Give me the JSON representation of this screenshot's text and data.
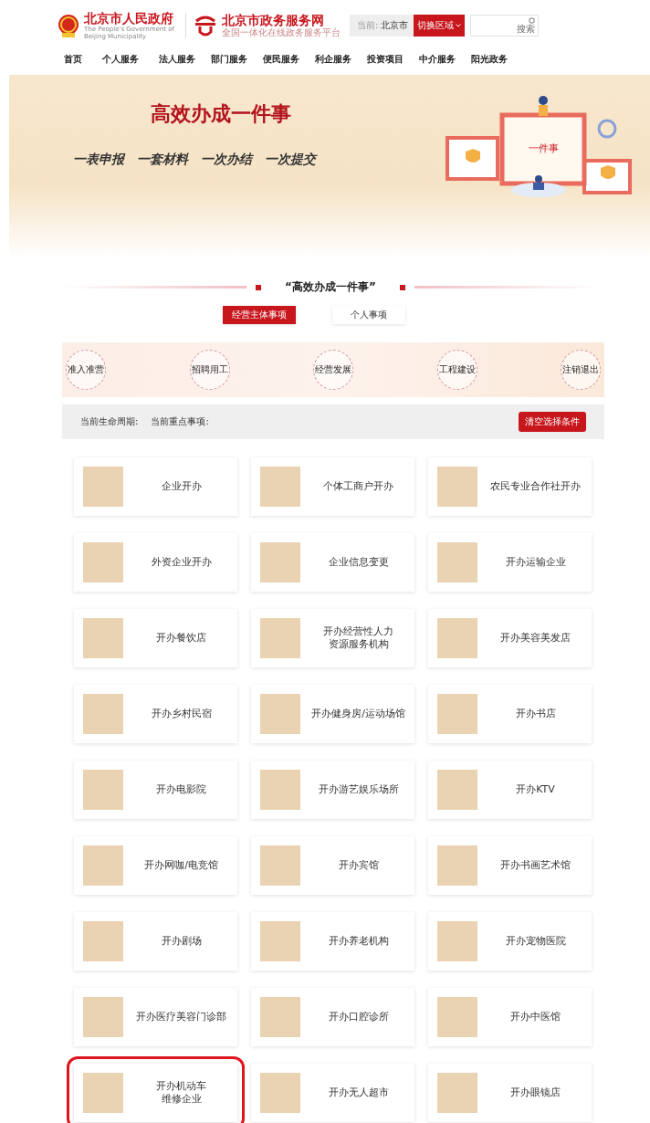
{
  "header": {
    "gov_title": "北京市人民政府",
    "gov_subtitle": "The People's Government of Beijing Municipality",
    "portal_title": "北京市政务服务网",
    "portal_subtitle": "全国一体化在线政务服务平台",
    "region_label": "当前:",
    "region_value": "北京市",
    "region_button": "切换区域",
    "search_label": "搜索"
  },
  "nav": [
    "首页",
    "个人服务",
    "法人服务",
    "部门服务",
    "便民服务",
    "利企服务",
    "投资项目",
    "中介服务",
    "阳光政务"
  ],
  "banner": {
    "title": "高效办成一件事",
    "slogans": [
      "一表申报",
      "一套材料",
      "一次办结",
      "一次提交"
    ],
    "screen_text": "一件事"
  },
  "section_title": "“高效办成一件事”",
  "tabs": [
    {
      "label": "经营主体事项",
      "selected": true
    },
    {
      "label": "个人事项",
      "selected": false
    }
  ],
  "lifecycle": [
    "准入准营",
    "招聘用工",
    "经营发展",
    "工程建设",
    "注销退出"
  ],
  "filter": {
    "period_label": "当前生命周期:",
    "focus_label": "当前重点事项:",
    "clear_button": "清空选择条件"
  },
  "cards": [
    {
      "lines": [
        "企业开办"
      ],
      "highlighted": false
    },
    {
      "lines": [
        "个体工商户开办"
      ],
      "highlighted": false
    },
    {
      "lines": [
        "农民专业合作社开办"
      ],
      "highlighted": false
    },
    {
      "lines": [
        "外资企业开办"
      ],
      "highlighted": false
    },
    {
      "lines": [
        "企业信息变更"
      ],
      "highlighted": false
    },
    {
      "lines": [
        "开办运输企业"
      ],
      "highlighted": false
    },
    {
      "lines": [
        "开办餐饮店"
      ],
      "highlighted": false
    },
    {
      "lines": [
        "开办经营性人力",
        "资源服务机构"
      ],
      "highlighted": false
    },
    {
      "lines": [
        "开办美容美发店"
      ],
      "highlighted": false
    },
    {
      "lines": [
        "开办乡村民宿"
      ],
      "highlighted": false
    },
    {
      "lines": [
        "开办健身房/运动场馆"
      ],
      "highlighted": false
    },
    {
      "lines": [
        "开办书店"
      ],
      "highlighted": false
    },
    {
      "lines": [
        "开办电影院"
      ],
      "highlighted": false
    },
    {
      "lines": [
        "开办游艺娱乐场所"
      ],
      "highlighted": false
    },
    {
      "lines": [
        "开办KTV"
      ],
      "highlighted": false
    },
    {
      "lines": [
        "开办网咖/电竞馆"
      ],
      "highlighted": false
    },
    {
      "lines": [
        "开办宾馆"
      ],
      "highlighted": false
    },
    {
      "lines": [
        "开办书画艺术馆"
      ],
      "highlighted": false
    },
    {
      "lines": [
        "开办剧场"
      ],
      "highlighted": false
    },
    {
      "lines": [
        "开办养老机构"
      ],
      "highlighted": false
    },
    {
      "lines": [
        "开办宠物医院"
      ],
      "highlighted": false
    },
    {
      "lines": [
        "开办医疗美容门诊部"
      ],
      "highlighted": false
    },
    {
      "lines": [
        "开办口腔诊所"
      ],
      "highlighted": false
    },
    {
      "lines": [
        "开办中医馆"
      ],
      "highlighted": false
    },
    {
      "lines": [
        "开办机动车",
        "维修企业"
      ],
      "highlighted": true
    },
    {
      "lines": [
        "开办无人超市"
      ],
      "highlighted": false
    },
    {
      "lines": [
        "开办眼镜店"
      ],
      "highlighted": false
    }
  ]
}
